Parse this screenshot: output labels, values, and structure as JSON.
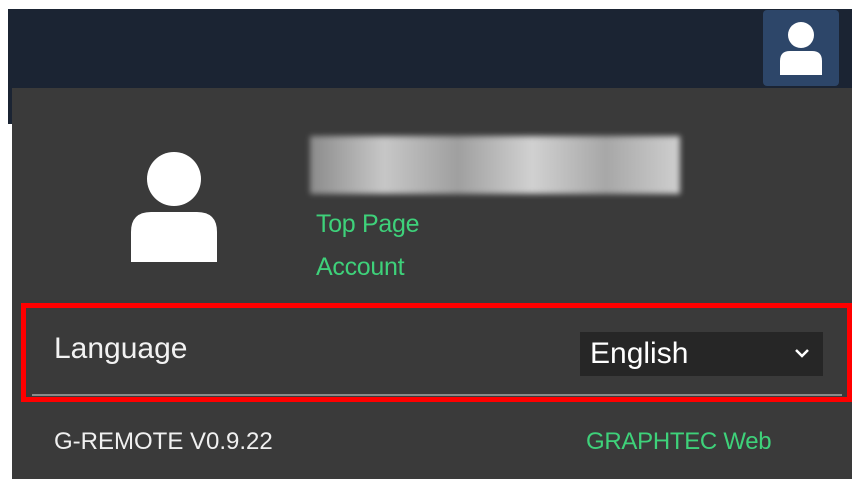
{
  "user_menu": {
    "links": [
      {
        "label": "Top Page"
      },
      {
        "label": "Account"
      }
    ],
    "language": {
      "label": "Language",
      "selected": "English"
    },
    "footer": {
      "version": "G-REMOTE V0.9.22",
      "web_link": "GRAPHTEC Web"
    }
  },
  "icons": {
    "header_user": "user-icon",
    "avatar": "user-icon",
    "dropdown": "chevron-down-icon"
  },
  "colors": {
    "topbar": "#1b2433",
    "panel": "#3a3a3a",
    "link": "#3ed17a",
    "highlight": "#ff0000"
  }
}
